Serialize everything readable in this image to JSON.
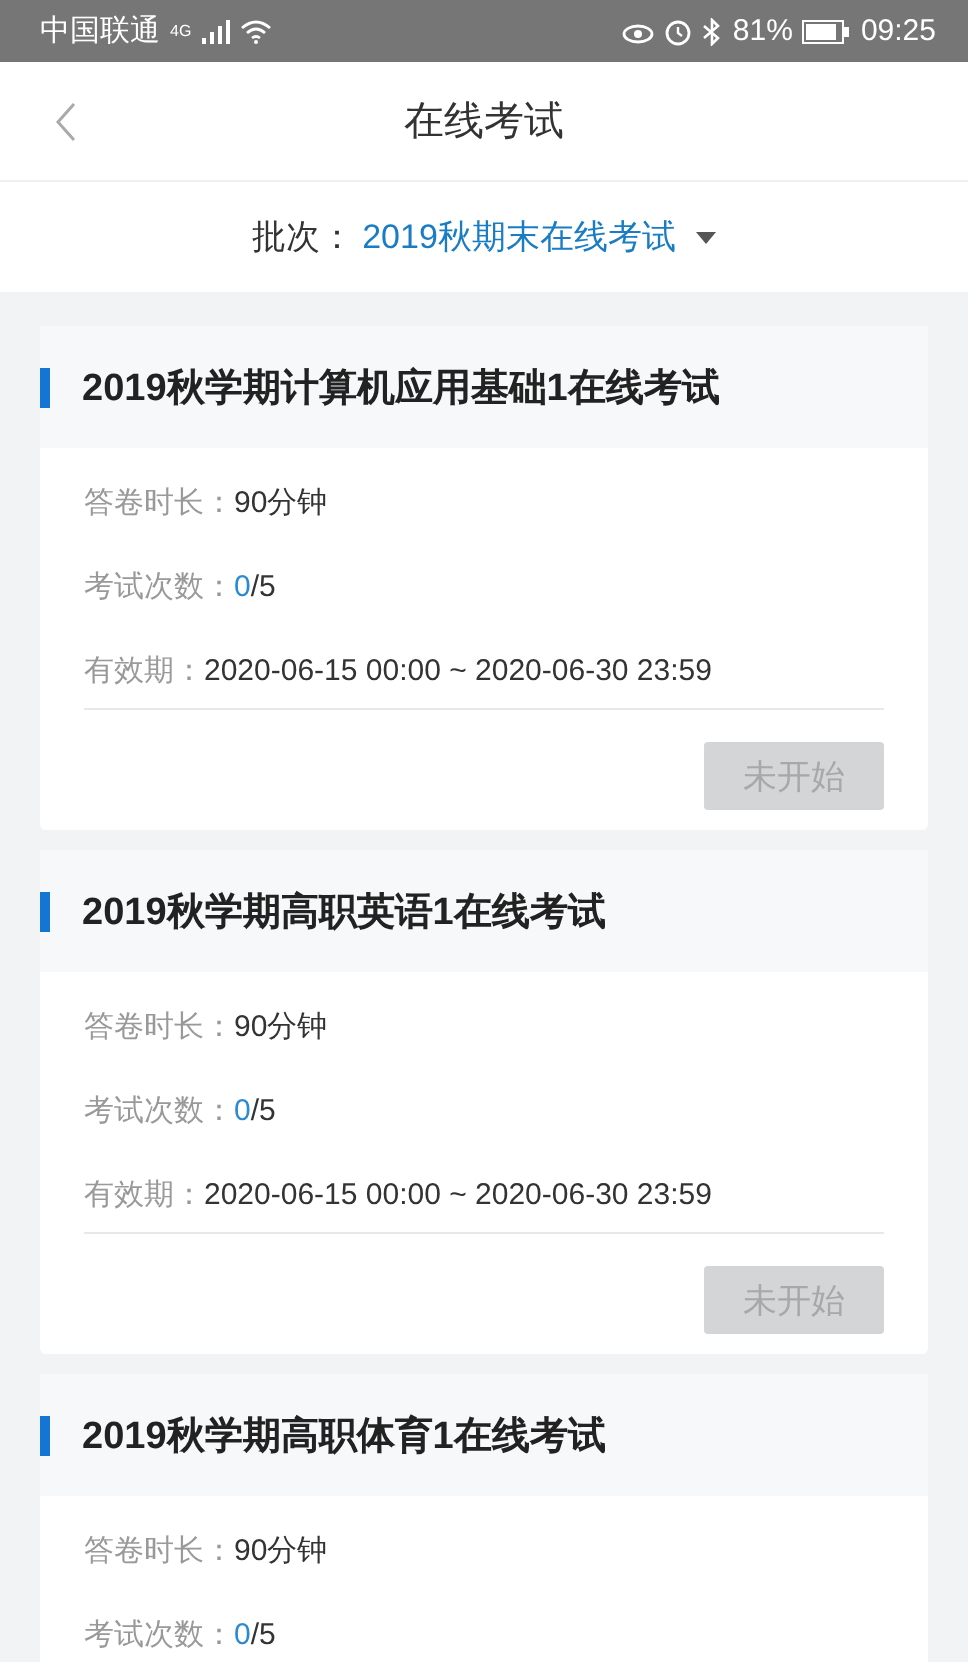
{
  "status_bar": {
    "carrier": "中国联通",
    "network": "4G",
    "battery": "81%",
    "time": "09:25"
  },
  "nav": {
    "title": "在线考试"
  },
  "batch": {
    "label": "批次：",
    "value": "2019秋期末在线考试"
  },
  "exams": [
    {
      "title": "2019秋学期计算机应用基础1在线考试",
      "fields": [
        {
          "label": "答卷时长：",
          "value": "90分钟"
        },
        {
          "label": "考试次数：",
          "done": "0",
          "total": "/5"
        },
        {
          "label": "有效期：",
          "value": "2020-06-15 00:00 ~ 2020-06-30 23:59"
        }
      ],
      "button": {
        "label": "未开始",
        "disabled": true
      }
    },
    {
      "title": "2019秋学期高职英语1在线考试",
      "fields": [
        {
          "label": "答卷时长：",
          "value": "90分钟"
        },
        {
          "label": "考试次数：",
          "done": "0",
          "total": "/5"
        },
        {
          "label": "有效期：",
          "value": "2020-06-15 00:00 ~ 2020-06-30 23:59"
        }
      ],
      "button": {
        "label": "未开始",
        "disabled": true
      }
    },
    {
      "title": "2019秋学期高职体育1在线考试",
      "fields": [
        {
          "label": "答卷时长：",
          "value": "90分钟"
        },
        {
          "label": "考试次数：",
          "done": "0",
          "total": "/5"
        }
      ]
    }
  ]
}
